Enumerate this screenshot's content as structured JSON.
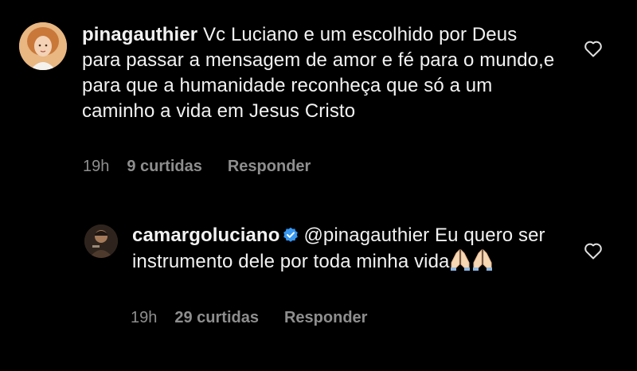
{
  "comments": [
    {
      "username": "pinagauthier",
      "text": "Vc Luciano  e um escolhido por Deus  para passar  a mensagem de amor  e fé para o mundo,e para que a humanidade reconheça que só  a um caminho a vida em Jesus Cristo",
      "time": "19h",
      "likes": "9 curtidas",
      "reply_label": "Responder"
    }
  ],
  "reply": {
    "username": "camargoluciano",
    "verified": true,
    "mention": "@pinagauthier",
    "text": "Eu quero ser instrumento dele por toda minha vida",
    "emojis": [
      "folded-hands",
      "folded-hands"
    ],
    "time": "19h",
    "likes": "29 curtidas",
    "reply_label": "Responder"
  },
  "colors": {
    "background": "#000000",
    "text": "#f2f2f2",
    "meta": "#8e8e8e",
    "verified": "#3897f0"
  }
}
